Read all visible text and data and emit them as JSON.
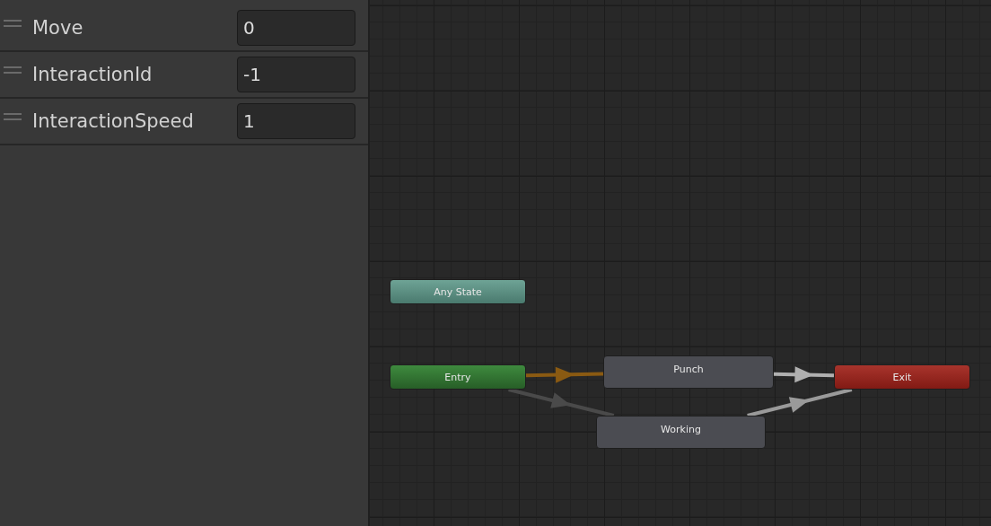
{
  "parameters": [
    {
      "name": "Move",
      "value": "0"
    },
    {
      "name": "InteractionId",
      "value": "-1"
    },
    {
      "name": "InteractionSpeed",
      "value": "1"
    }
  ],
  "graph": {
    "states": [
      {
        "label": "Any State",
        "kind": "any"
      },
      {
        "label": "Entry",
        "kind": "entry"
      },
      {
        "label": "Punch",
        "kind": "state"
      },
      {
        "label": "Working",
        "kind": "state"
      },
      {
        "label": "Exit",
        "kind": "exit"
      }
    ],
    "transitions": [
      {
        "color": "#8a5a12"
      },
      {
        "color": "#4a4a4a"
      },
      {
        "color": "#b0b0b0"
      },
      {
        "color": "#9a9a9a"
      }
    ]
  }
}
